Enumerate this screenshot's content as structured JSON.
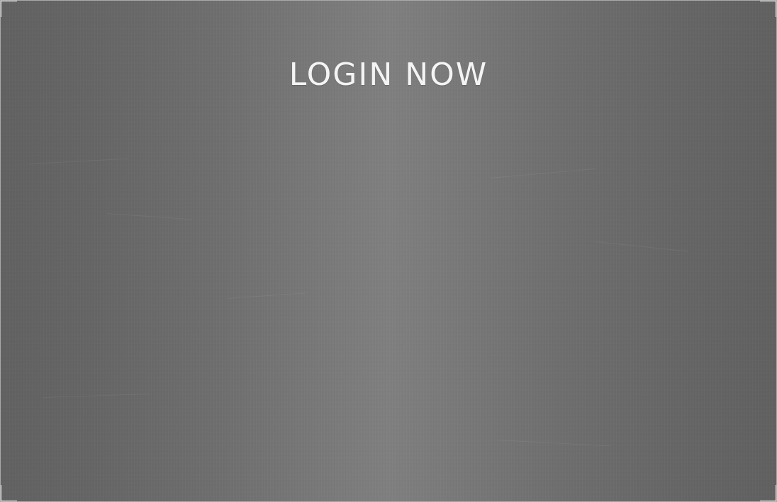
{
  "login": {
    "title": "LOGIN NOW"
  },
  "colors": {
    "panel_edge": "#616161",
    "panel_center": "#7f7f7f",
    "title_text": "#f4f4f4",
    "corner_marks": "#f0f0f0"
  }
}
